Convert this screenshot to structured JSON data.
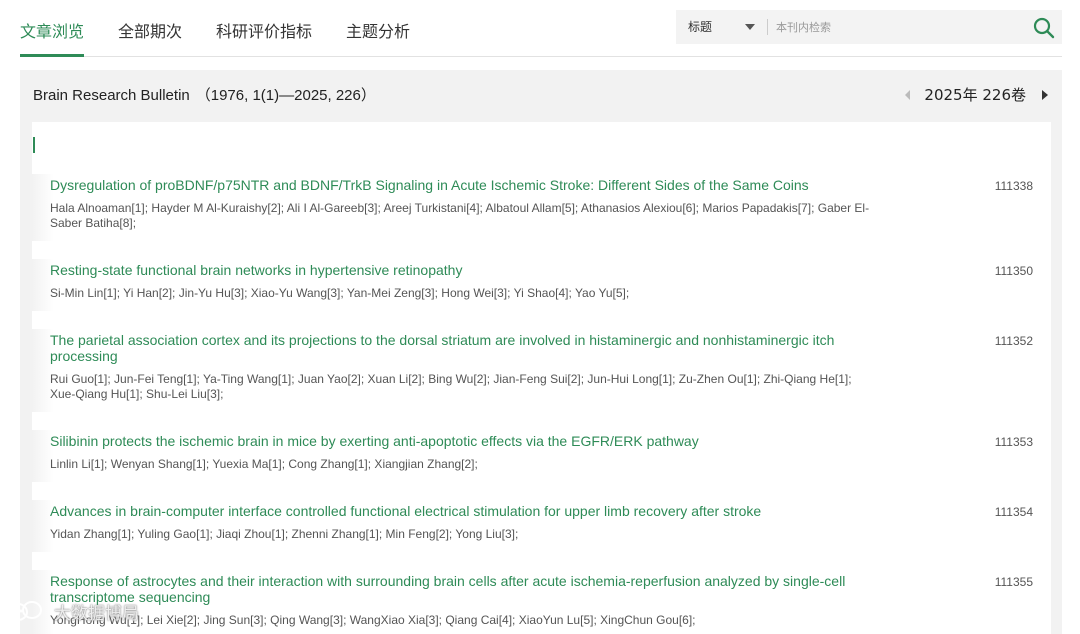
{
  "nav": {
    "tabs": [
      {
        "label": "文章浏览",
        "active": true
      },
      {
        "label": "全部期次",
        "active": false
      },
      {
        "label": "科研评价指标",
        "active": false
      },
      {
        "label": "主题分析",
        "active": false
      }
    ]
  },
  "search": {
    "field_selected": "标题",
    "placeholder": "本刊内检索",
    "icon": "search-icon"
  },
  "journal": {
    "name": "Brain Research Bulletin",
    "range": "（1976, 1(1)—2025, 226）",
    "current_volume": "2025年 226卷"
  },
  "articles": [
    {
      "title": "Dysregulation of proBDNF/p75NTR and BDNF/TrkB Signaling in Acute Ischemic Stroke: Different Sides of the Same Coins",
      "authors": "Hala Alnoaman[1]; Hayder M Al-Kuraishy[2]; Ali I Al-Gareeb[3]; Areej Turkistani[4]; Albatoul Allam[5]; Athanasios Alexiou[6]; Marios Papadakis[7]; Gaber El-Saber Batiha[8];",
      "page": "111338"
    },
    {
      "title": "Resting-state functional brain networks in hypertensive retinopathy",
      "authors": "Si-Min Lin[1]; Yi Han[2]; Jin-Yu Hu[3]; Xiao-Yu Wang[3]; Yan-Mei Zeng[3]; Hong Wei[3]; Yi Shao[4]; Yao Yu[5];",
      "page": "111350"
    },
    {
      "title": "The parietal association cortex and its projections to the dorsal striatum are involved in histaminergic and nonhistaminergic itch processing",
      "authors": "Rui Guo[1]; Jun-Fei Teng[1]; Ya-Ting Wang[1]; Juan Yao[2]; Xuan Li[2]; Bing Wu[2]; Jian-Feng Sui[2]; Jun-Hui Long[1]; Zu-Zhen Ou[1]; Zhi-Qiang He[1]; Xue-Qiang Hu[1]; Shu-Lei Liu[3];",
      "page": "111352"
    },
    {
      "title": "Silibinin protects the ischemic brain in mice by exerting anti-apoptotic effects via the EGFR/ERK pathway",
      "authors": "Linlin Li[1]; Wenyan Shang[1]; Yuexia Ma[1]; Cong Zhang[1]; Xiangjian Zhang[2];",
      "page": "111353"
    },
    {
      "title": "Advances in brain-computer interface controlled functional electrical stimulation for upper limb recovery after stroke",
      "authors": "Yidan Zhang[1]; Yuling Gao[1]; Jiaqi Zhou[1]; Zhenni Zhang[1]; Min Feng[2]; Yong Liu[3];",
      "page": "111354"
    },
    {
      "title": "Response of astrocytes and their interaction with surrounding brain cells after acute ischemia-reperfusion analyzed by single-cell transcriptome sequencing",
      "authors": "YongHong Wu[1]; Lei Xie[2]; Jing Sun[3]; Qing Wang[3]; WangXiao Xia[3]; Qiang Cai[4]; XiaoYun Lu[5]; XingChun Gou[6];",
      "page": "111355"
    }
  ],
  "watermark": {
    "text": "大数据博局"
  },
  "colors": {
    "accent": "#2e8b57",
    "panel_bg": "#f2f2f2"
  }
}
